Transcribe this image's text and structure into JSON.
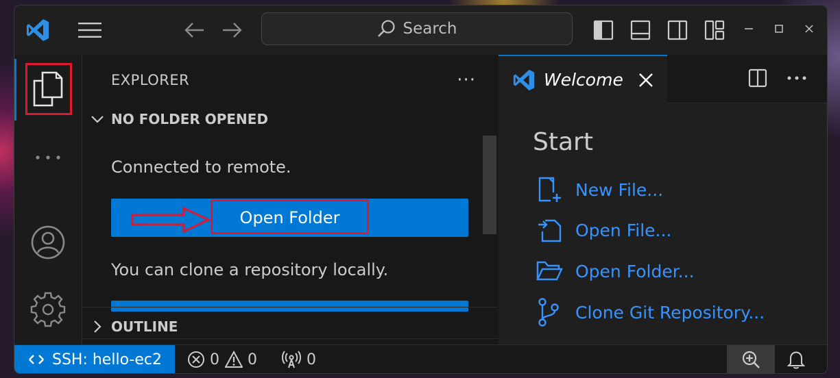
{
  "title_bar": {
    "search_placeholder": "Search",
    "icons": [
      "vscode-logo-icon",
      "menu-icon",
      "back-arrow-icon",
      "forward-arrow-icon",
      "toggle-sidebar-icon",
      "toggle-panel-icon",
      "toggle-secondary-sidebar-icon",
      "customize-layout-icon",
      "minimize-icon",
      "maximize-icon",
      "close-icon"
    ]
  },
  "activity_bar": {
    "items": [
      "explorer-icon",
      "more-icon",
      "account-icon",
      "settings-gear-icon"
    ]
  },
  "sidebar": {
    "title": "EXPLORER",
    "more": "···",
    "section_no_folder": "NO FOLDER OPENED",
    "connected_text": "Connected to remote.",
    "open_folder_button": "Open Folder",
    "clone_text": "You can clone a repository locally.",
    "section_outline": "OUTLINE"
  },
  "editor": {
    "tab_label": "Welcome",
    "start_title": "Start",
    "start_items": [
      "New File...",
      "Open File...",
      "Open Folder...",
      "Clone Git Repository..."
    ]
  },
  "status_bar": {
    "remote_label": "SSH: hello-ec2",
    "errors": "0",
    "warnings": "0",
    "ports": "0"
  },
  "colors": {
    "accent": "#0078d4",
    "link": "#3794ff",
    "highlight": "#e0182d",
    "background": "#181818"
  }
}
